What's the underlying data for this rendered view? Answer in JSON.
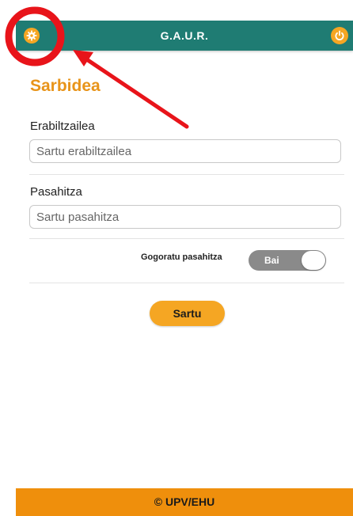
{
  "header": {
    "title": "G.A.U.R.",
    "settings_icon": "gear-icon",
    "power_icon": "power-icon",
    "accent_color": "#1f7c73"
  },
  "main": {
    "page_title": "Sarbidea",
    "username": {
      "label": "Erabiltzailea",
      "placeholder": "Sartu erabiltzailea",
      "value": ""
    },
    "password": {
      "label": "Pasahitza",
      "placeholder": "Sartu pasahitza",
      "value": ""
    },
    "remember": {
      "label": "Gogoratu pasahitza",
      "toggle_text": "Bai",
      "state": "on"
    },
    "submit_label": "Sartu"
  },
  "footer": {
    "text": "© UPV/EHU",
    "color": "#ef8f0c"
  },
  "annotation": {
    "highlight_color": "#e8141a"
  }
}
